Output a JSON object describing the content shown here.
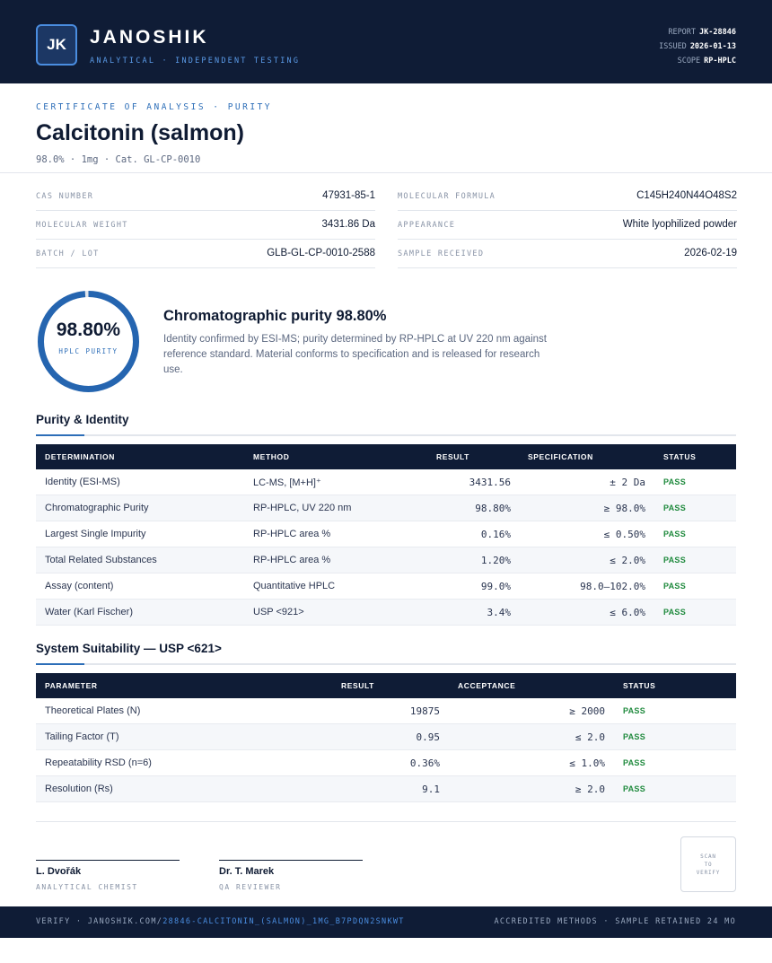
{
  "header": {
    "logo_initials": "JK",
    "brand": "JANOSHIK",
    "brand_sub": "ANALYTICAL · INDEPENDENT TESTING",
    "report_label": "REPORT",
    "report_value": "JK-28846",
    "issued_label": "ISSUED",
    "issued_value": "2026-01-13",
    "scope_label": "SCOPE",
    "scope_value": "RP-HPLC"
  },
  "certificate": {
    "eyebrow": "CERTIFICATE OF ANALYSIS · PURITY",
    "title": "Calcitonin (salmon)",
    "subtitle": "98.0% · 1mg  ·  Cat. GL-CP-0010"
  },
  "info": [
    {
      "label": "CAS NUMBER",
      "value": "47931-85-1"
    },
    {
      "label": "MOLECULAR FORMULA",
      "value": "C145H240N44O48S2"
    },
    {
      "label": "MOLECULAR WEIGHT",
      "value": "3431.86 Da"
    },
    {
      "label": "APPEARANCE",
      "value": "White lyophilized powder"
    },
    {
      "label": "BATCH / LOT",
      "value": "GLB-GL-CP-0010-2588"
    },
    {
      "label": "SAMPLE RECEIVED",
      "value": "2026-02-19"
    }
  ],
  "purity": {
    "percent_text": "98.80%",
    "fraction": 0.988,
    "ring_label": "HPLC PURITY",
    "headline": "Chromatographic purity 98.80%",
    "description": "Identity confirmed by ESI-MS; purity determined by RP-HPLC at UV 220 nm against reference standard. Material conforms to specification and is released for research use."
  },
  "purity_table": {
    "section_title": "Purity & Identity",
    "headers": {
      "determination": "DETERMINATION",
      "method": "METHOD",
      "result": "RESULT",
      "specification": "SPECIFICATION",
      "status": "STATUS"
    },
    "rows": [
      {
        "determination": "Identity (ESI-MS)",
        "method": "LC-MS, [M+H]⁺",
        "result": "3431.56",
        "specification": "± 2 Da",
        "status": "PASS"
      },
      {
        "determination": "Chromatographic Purity",
        "method": "RP-HPLC, UV 220 nm",
        "result": "98.80%",
        "specification": "≥ 98.0%",
        "status": "PASS"
      },
      {
        "determination": "Largest Single Impurity",
        "method": "RP-HPLC area %",
        "result": "0.16%",
        "specification": "≤ 0.50%",
        "status": "PASS"
      },
      {
        "determination": "Total Related Substances",
        "method": "RP-HPLC area %",
        "result": "1.20%",
        "specification": "≤ 2.0%",
        "status": "PASS"
      },
      {
        "determination": "Assay (content)",
        "method": "Quantitative HPLC",
        "result": "99.0%",
        "specification": "98.0–102.0%",
        "status": "PASS"
      },
      {
        "determination": "Water (Karl Fischer)",
        "method": "USP <921>",
        "result": "3.4%",
        "specification": "≤ 6.0%",
        "status": "PASS"
      }
    ]
  },
  "suitability_table": {
    "section_title": "System Suitability — USP <621>",
    "headers": {
      "parameter": "PARAMETER",
      "result": "RESULT",
      "acceptance": "ACCEPTANCE",
      "status": "STATUS"
    },
    "rows": [
      {
        "parameter": "Theoretical Plates (N)",
        "result": "19875",
        "acceptance": "≥ 2000",
        "status": "PASS"
      },
      {
        "parameter": "Tailing Factor (T)",
        "result": "0.95",
        "acceptance": "≤ 2.0",
        "status": "PASS"
      },
      {
        "parameter": "Repeatability RSD (n=6)",
        "result": "0.36%",
        "acceptance": "≤ 1.0%",
        "status": "PASS"
      },
      {
        "parameter": "Resolution (Rs)",
        "result": "9.1",
        "acceptance": "≥ 2.0",
        "status": "PASS"
      }
    ]
  },
  "signatures": [
    {
      "name": "L. Dvořák",
      "role": "ANALYTICAL CHEMIST"
    },
    {
      "name": "Dr. T. Marek",
      "role": "QA REVIEWER"
    }
  ],
  "qr": {
    "line1": "SCAN",
    "line2": "TO",
    "line3": "VERIFY"
  },
  "footer": {
    "verify_prefix": "VERIFY · JANOSHIK.COM/",
    "verify_path": "28846-CALCITONIN_(SALMON)_1MG_B7PDQN2SNKWT",
    "right": "ACCREDITED METHODS · SAMPLE RETAINED 24 MO"
  },
  "colors": {
    "navy": "#0f1c36",
    "accent": "#2d6eb8",
    "pass": "#1f8a3d"
  }
}
